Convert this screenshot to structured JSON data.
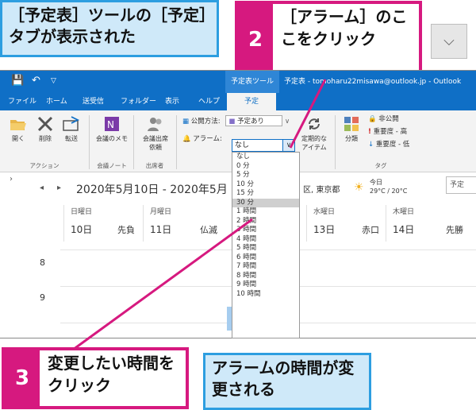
{
  "callouts": {
    "note1": "［予定表］ツールの［予定］タブが表示された",
    "step2_num": "2",
    "step2": "［アラーム］のここをクリック",
    "step3_num": "3",
    "step3": "変更したい時間をクリック",
    "note2": "アラームの時間が変更される"
  },
  "collapse_icon": "chevron-down-icon",
  "title_bar": {
    "context_group": "予定表ツール",
    "title": "予定表 - tomoharu22misawa@outlook.jp - Outlook"
  },
  "tabs": [
    "ファイル",
    "ホーム",
    "送受信",
    "フォルダー",
    "表示",
    "ヘルプ",
    "予定"
  ],
  "ribbon": {
    "open": "開く",
    "delete": "削除",
    "forward": "転送",
    "meeting_notes": "会議のメモ",
    "attendees": "会議出席\n依頼",
    "group_action": "アクション",
    "group_notes": "会議ノート",
    "group_attendees": "出席者",
    "show_as_label": "公開方法:",
    "show_as_value": "予定あり",
    "alarm_label": "アラーム:",
    "alarm_value": "なし",
    "recurrence": "定期的な\nアイテム",
    "categorize": "分類",
    "private": "非公開",
    "high": "重要度 - 高",
    "low": "重要度 - 低",
    "group_tags": "タグ"
  },
  "calendar": {
    "range": "2020年5月10日 - 2020年5月",
    "location": "区, 東京都",
    "today_label": "今日",
    "temp": "29°C / 20°C",
    "search_hint": "予定",
    "days": [
      {
        "name": "日曜日",
        "date": "10日",
        "note": "先負"
      },
      {
        "name": "月曜日",
        "date": "11日",
        "note": "仏滅"
      },
      {
        "name": "水曜日",
        "date": "13日",
        "note": "赤口"
      },
      {
        "name": "木曜日",
        "date": "14日",
        "note": "先勝"
      }
    ],
    "hours": [
      "8",
      "9"
    ]
  },
  "alarm_options": [
    "なし",
    "0 分",
    "5 分",
    "10 分",
    "15 分",
    "30 分",
    "1 時間",
    "2 時間",
    "3 時間",
    "4 時間",
    "5 時間",
    "6 時間",
    "7 時間",
    "8 時間",
    "9 時間",
    "10 時間"
  ],
  "highlighted_option": "30 分",
  "colors": {
    "accent": "#0f6fc6",
    "callout_pink": "#d6197f",
    "callout_blue": "#2d9ee0"
  }
}
